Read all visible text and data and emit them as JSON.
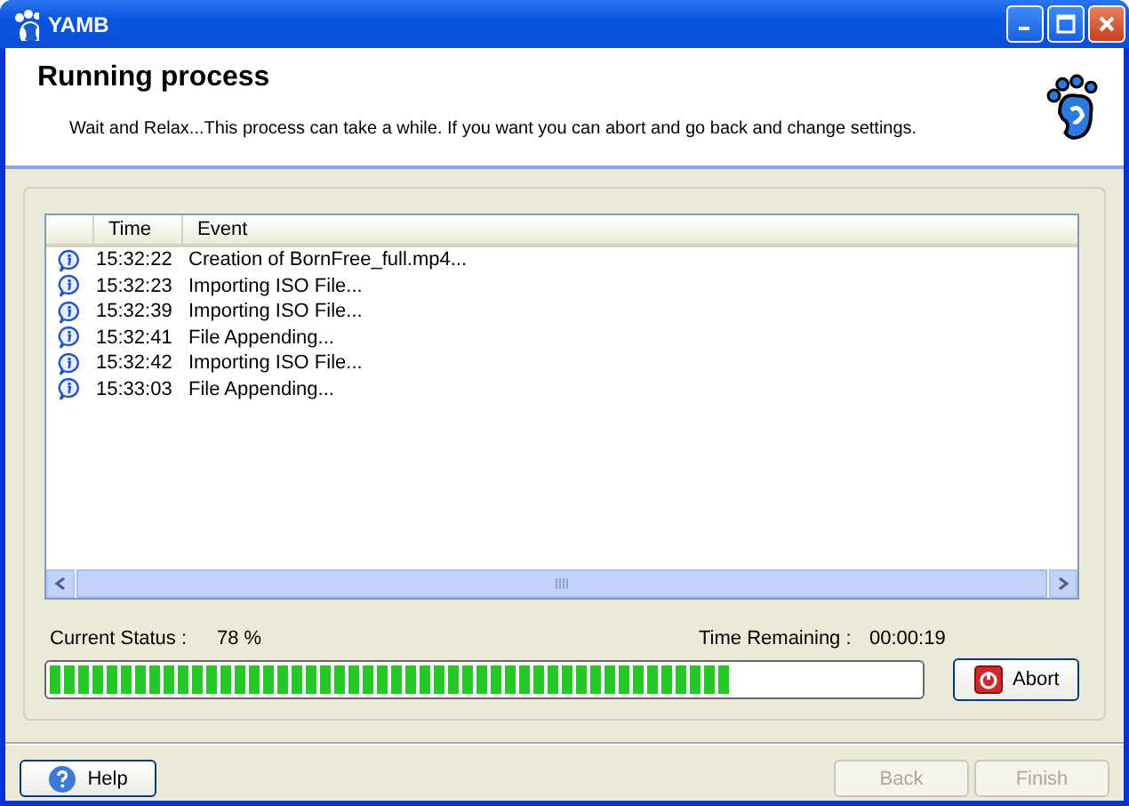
{
  "window": {
    "title": "YAMB"
  },
  "header": {
    "title": "Running process",
    "subtitle": "Wait and Relax...This process can take a while. If you want you can abort and go back and change settings."
  },
  "log": {
    "columns": [
      "Time",
      "Event"
    ],
    "rows": [
      {
        "time": "15:32:22",
        "event": "Creation of BornFree_full.mp4..."
      },
      {
        "time": "15:32:23",
        "event": "Importing ISO File..."
      },
      {
        "time": "15:32:39",
        "event": "Importing ISO File..."
      },
      {
        "time": "15:32:41",
        "event": "File Appending..."
      },
      {
        "time": "15:32:42",
        "event": "Importing ISO File..."
      },
      {
        "time": "15:33:03",
        "event": "File Appending..."
      }
    ]
  },
  "status": {
    "label": "Current Status :",
    "value": "78 %",
    "remaining_label": "Time Remaining :",
    "remaining": "00:00:19",
    "level": 0.78
  },
  "abort_button": {
    "label": "Abort",
    "disabled": false
  },
  "buttons": [
    {
      "kind": "help",
      "label": "Help",
      "disabled": false
    },
    {
      "kind": "nav",
      "label": "Back",
      "disabled": true
    },
    {
      "kind": "nav",
      "label": "Finish",
      "disabled": true
    }
  ]
}
